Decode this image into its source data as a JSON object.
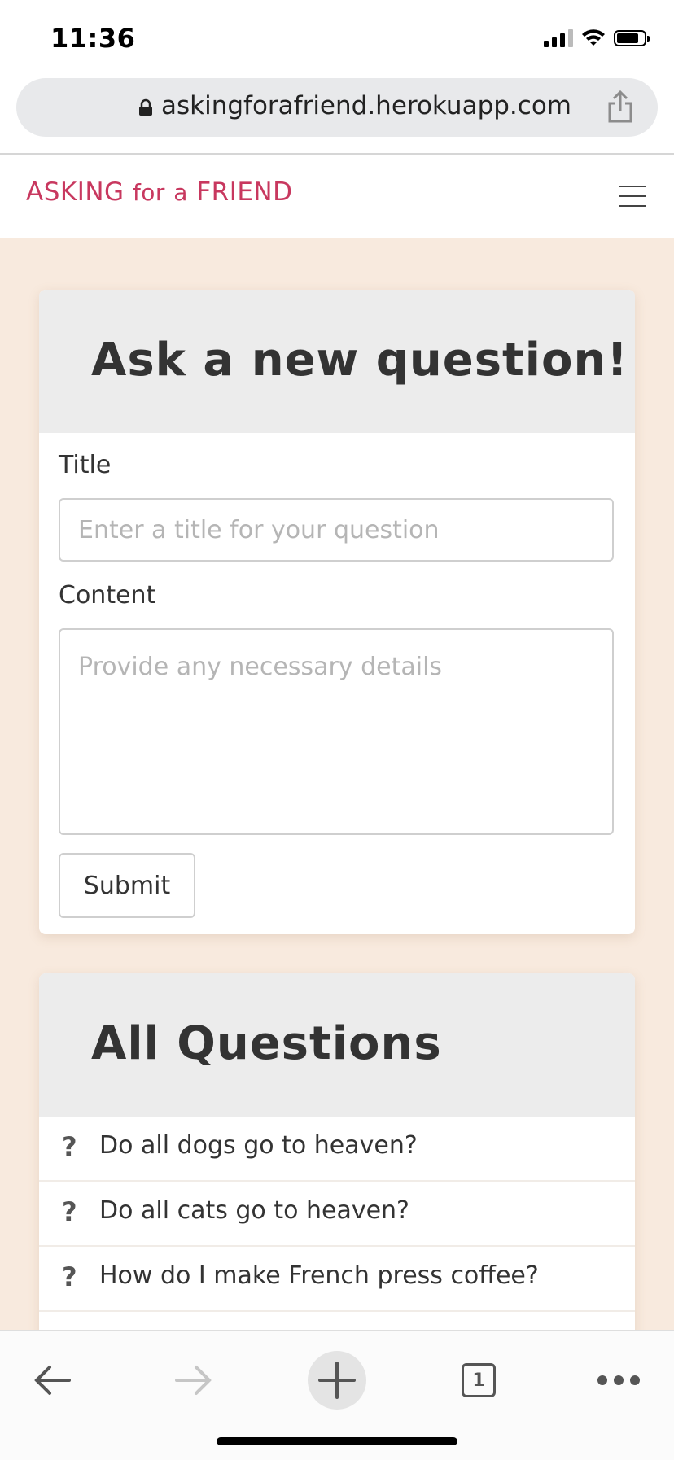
{
  "status_bar": {
    "time": "11:36"
  },
  "browser": {
    "url": "askingforafriend.herokuapp.com",
    "open_tabs": "1"
  },
  "site": {
    "brand_part1": "ASKING",
    "brand_part2": "for",
    "brand_part3": "a",
    "brand_part4": "FRIEND"
  },
  "new_question": {
    "heading": "Ask a new question!",
    "title_label": "Title",
    "title_placeholder": "Enter a title for your question",
    "content_label": "Content",
    "content_placeholder": "Provide any necessary details",
    "submit_label": "Submit"
  },
  "questions": {
    "heading": "All Questions",
    "icon_glyph": "?",
    "items": [
      {
        "title": "Do all dogs go to heaven?"
      },
      {
        "title": "Do all cats go to heaven?"
      },
      {
        "title": "How do I make French press coffee?"
      }
    ]
  },
  "colors": {
    "brand": "#c8385f",
    "page_background": "#f8eade",
    "card_header": "#ececec"
  },
  "icons": [
    "lock-icon",
    "share-icon",
    "hamburger-menu-icon",
    "question-mark-icon",
    "back-arrow-icon",
    "forward-arrow-icon",
    "new-tab-plus-icon",
    "tabs-icon",
    "more-dots-icon"
  ]
}
